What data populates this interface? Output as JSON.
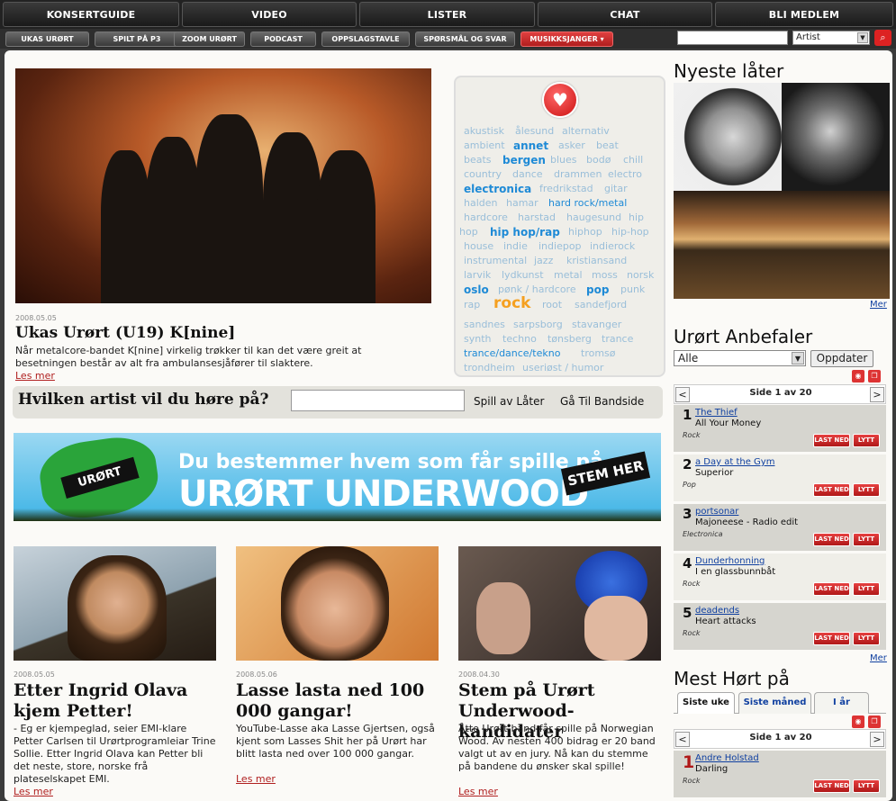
{
  "top_nav": [
    "KONSERTGUIDE",
    "VIDEO",
    "LISTER",
    "CHAT",
    "BLI MEDLEM"
  ],
  "sub_nav": [
    "UKAS URØRT",
    "SPILT PÅ P3",
    "ZOOM URØRT",
    "PODCAST",
    "OPPSLAGSTAVLE",
    "SPØRSMÅL OG SVAR",
    "MUSIKKSJANGER ▾"
  ],
  "search": {
    "value": "",
    "select_value": "Artist",
    "button": "⌕"
  },
  "featured": {
    "date": "2008.05.05",
    "title": "Ukas Urørt (U19) K[nine]",
    "text": "Når metalcore-bandet K[nine] virkelig trøkker til kan det være greit at besetningen består av alt fra ambulansesjåfører til slaktere.",
    "more": "Les mer"
  },
  "tags": [
    {
      "t": "akustisk",
      "s": 0
    },
    {
      "t": "ålesund",
      "s": 0
    },
    {
      "t": "alternativ",
      "s": 0
    },
    {
      "t": "ambient",
      "s": 0
    },
    {
      "t": "annet",
      "s": 1
    },
    {
      "t": "asker",
      "s": 0
    },
    {
      "t": "beat",
      "s": 0
    },
    {
      "t": "beats",
      "s": 0
    },
    {
      "t": "bergen",
      "s": 1
    },
    {
      "t": "blues",
      "s": 0
    },
    {
      "t": "bodø",
      "s": 0
    },
    {
      "t": "chill",
      "s": 0
    },
    {
      "t": "country",
      "s": 0
    },
    {
      "t": "dance",
      "s": 0
    },
    {
      "t": "drammen",
      "s": 0
    },
    {
      "t": "electro",
      "s": 0
    },
    {
      "t": "electronica",
      "s": 1
    },
    {
      "t": "fredrikstad",
      "s": 0
    },
    {
      "t": "gitar",
      "s": 0
    },
    {
      "t": "halden",
      "s": 0
    },
    {
      "t": "hamar",
      "s": 0
    },
    {
      "t": "hard rock/metal",
      "s": 2
    },
    {
      "t": "hardcore",
      "s": 0
    },
    {
      "t": "harstad",
      "s": 0
    },
    {
      "t": "haugesund",
      "s": 0
    },
    {
      "t": "hip",
      "s": 0
    },
    {
      "t": "hop",
      "s": 0
    },
    {
      "t": "hip hop/rap",
      "s": 1
    },
    {
      "t": "hiphop",
      "s": 0
    },
    {
      "t": "hip-hop",
      "s": 0
    },
    {
      "t": "house",
      "s": 0
    },
    {
      "t": "indie",
      "s": 0
    },
    {
      "t": "indiepop",
      "s": 0
    },
    {
      "t": "indierock",
      "s": 0
    },
    {
      "t": "instrumental",
      "s": 0
    },
    {
      "t": "jazz",
      "s": 0
    },
    {
      "t": "kristiansand",
      "s": 0
    },
    {
      "t": "larvik",
      "s": 0
    },
    {
      "t": "lydkunst",
      "s": 0
    },
    {
      "t": "metal",
      "s": 0
    },
    {
      "t": "moss",
      "s": 0
    },
    {
      "t": "norsk",
      "s": 0
    },
    {
      "t": "oslo",
      "s": 1
    },
    {
      "t": "pønk / hardcore",
      "s": 0
    },
    {
      "t": "pop",
      "s": 1
    },
    {
      "t": "punk",
      "s": 0
    },
    {
      "t": "rap",
      "s": 0
    },
    {
      "t": "rock",
      "s": 3
    },
    {
      "t": "root",
      "s": 0
    },
    {
      "t": "sandefjord",
      "s": 0
    },
    {
      "t": "sandnes",
      "s": 0
    },
    {
      "t": "sarpsborg",
      "s": 0
    },
    {
      "t": "stavanger",
      "s": 0
    },
    {
      "t": "synth",
      "s": 0
    },
    {
      "t": "techno",
      "s": 0
    },
    {
      "t": "tønsberg",
      "s": 0
    },
    {
      "t": "trance",
      "s": 0
    },
    {
      "t": "trance/dance/tekno",
      "s": 2
    },
    {
      "t": "tromsø",
      "s": 0
    },
    {
      "t": "trondheim",
      "s": 0
    },
    {
      "t": "useriøst / humor",
      "s": 0
    }
  ],
  "ask": {
    "label": "Hvilken artist vil du høre på?",
    "input": "",
    "btn1": "Spill av Låter",
    "btn2": "Gå Til Bandside"
  },
  "banner": {
    "line1": "Du bestemmer hvem som får spille på",
    "line2": "URØRT UNDERWOOD",
    "stem": "STEM HER",
    "logo": "URØRT"
  },
  "articles": [
    {
      "date": "2008.05.05",
      "title": "Etter Ingrid Olava kjem Petter!",
      "text": "- Eg er kjempeglad, seier EMI-klare Petter Carlsen til Urørtprogramleiar Trine Sollie. Etter Ingrid Olava kan Petter bli det neste, store, norske frå plateselskapet EMI.",
      "more": "Les mer"
    },
    {
      "date": "2008.05.06",
      "title": "Lasse lasta ned 100 000 gangar!",
      "text": "YouTube-Lasse aka Lasse Gjertsen, også kjent som Lasses Shit her på Urørt har blitt lasta ned over 100 000 gangar.",
      "more": "Les mer"
    },
    {
      "date": "2008.04.30",
      "title": "Stem på Urørt Underwood-kandidater",
      "text": "Åtte Urørt-band får spille på Norwegian Wood. Av nesten 400 bidrag er 20 band valgt ut av en jury. Nå kan du stemme på bandene du ønsker skal spille!",
      "more": "Les mer"
    }
  ],
  "nyeste": {
    "title": "Nyeste låter",
    "more": "Mer"
  },
  "anbefaler": {
    "title": "Urørt Anbefaler",
    "filter": "Alle",
    "update": "Oppdater",
    "page": "Side 1 av 20",
    "more": "Mer",
    "items": [
      {
        "n": "1",
        "artist": "The Thief",
        "song": "All Your Money",
        "genre": "Rock"
      },
      {
        "n": "2",
        "artist": "a Day at the Gym",
        "song": "Superior",
        "genre": "Pop"
      },
      {
        "n": "3",
        "artist": "portsonar",
        "song": "Majoneese - Radio edit",
        "genre": "Electronica"
      },
      {
        "n": "4",
        "artist": "Dunderhonning",
        "song": "I en glassbunnbåt",
        "genre": "Rock"
      },
      {
        "n": "5",
        "artist": "deadends",
        "song": "Heart attacks",
        "genre": "Rock"
      }
    ],
    "btn_download": "LAST NED",
    "btn_listen": "LYTT"
  },
  "mest": {
    "title": "Mest Hørt på",
    "tabs": [
      "Siste uke",
      "Siste måned",
      "I år"
    ],
    "page": "Side 1 av 20",
    "items": [
      {
        "n": "1",
        "artist": "Andre Holstad",
        "song": "Darling",
        "genre": "Rock"
      }
    ]
  }
}
